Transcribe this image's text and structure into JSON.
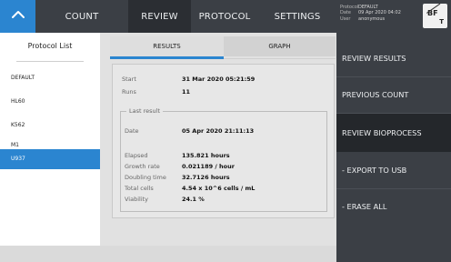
{
  "nav": {
    "tabs": [
      {
        "label": "COUNT"
      },
      {
        "label": "REVIEW"
      },
      {
        "label": "PROTOCOL"
      },
      {
        "label": "SETTINGS"
      }
    ],
    "info": {
      "protocol_key": "Protocol",
      "protocol_value": "DEFAULT",
      "date_key": "Date",
      "date_value": "09 Apr 2020 04:02",
      "user_key": "User",
      "user_value": "anonymous"
    },
    "badge": {
      "top": "BF",
      "bottom": "T"
    }
  },
  "protocol_list": {
    "title": "Protocol List",
    "items": [
      "DEFAULT",
      "HL60",
      "K562",
      "M1",
      "U937"
    ],
    "selected": "U937"
  },
  "subtabs": {
    "results": "RESULTS",
    "graph": "GRAPH"
  },
  "results": {
    "start_label": "Start",
    "start_value": "31 Mar 2020 05:21:59",
    "runs_label": "Runs",
    "runs_value": "11",
    "last_result_title": "Last result",
    "date_label": "Date",
    "date_value": "05 Apr 2020 21:11:13",
    "elapsed_label": "Elapsed",
    "elapsed_value": "135.821 hours",
    "growth_label": "Growth rate",
    "growth_value": "0.021189 / hour",
    "doubling_label": "Doubling time",
    "doubling_value": "32.7126 hours",
    "total_label": "Total cells",
    "total_value": "4.54 x 10^6 cells / mL",
    "viability_label": "Viability",
    "viability_value": "24.1 %"
  },
  "menu": {
    "items": [
      "REVIEW RESULTS",
      "PREVIOUS COUNT",
      "REVIEW BIOPROCESS",
      "- EXPORT TO USB",
      "- ERASE ALL"
    ],
    "active": "REVIEW BIOPROCESS"
  },
  "colors": {
    "accent": "#2b85d0",
    "nav_bg": "#3b3f45",
    "nav_active": "#2b2e33",
    "menu_active": "#24272b"
  }
}
